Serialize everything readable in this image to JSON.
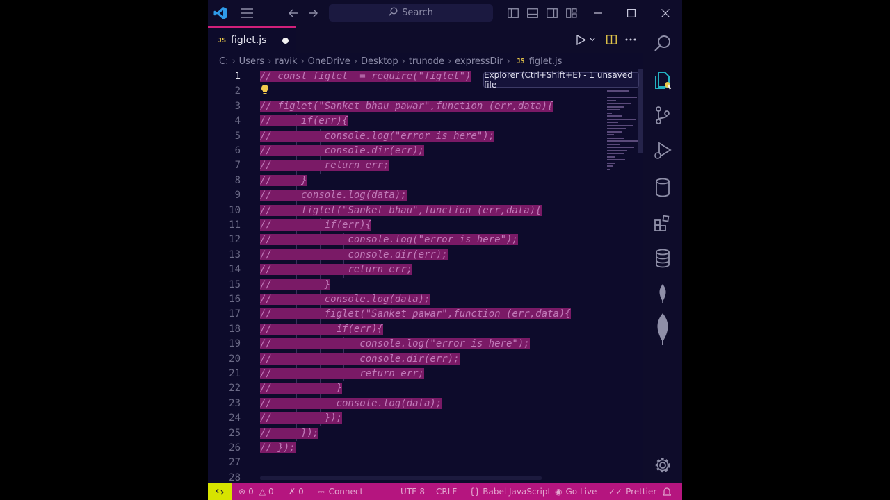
{
  "titlebar": {
    "search_label": "Search"
  },
  "tab": {
    "badge": "JS",
    "filename": "figlet.js"
  },
  "breadcrumb": [
    "C:",
    "Users",
    "ravik",
    "OneDrive",
    "Desktop",
    "trunode",
    "expressDir",
    "figlet.js"
  ],
  "breadcrumb_file_badge": "JS",
  "tooltip": "Explorer (Ctrl+Shift+E) - 1 unsaved file",
  "code_lines": [
    {
      "n": "1",
      "text": "// const figlet  = require(\"figlet\")"
    },
    {
      "n": "2",
      "text": ""
    },
    {
      "n": "3",
      "text": "// figlet(\"Sanket bhau pawar\",function (err,data){"
    },
    {
      "n": "4",
      "text": "//     if(err){"
    },
    {
      "n": "5",
      "text": "//         console.log(\"error is here\");"
    },
    {
      "n": "6",
      "text": "//         console.dir(err);"
    },
    {
      "n": "7",
      "text": "//         return err;"
    },
    {
      "n": "8",
      "text": "//     }"
    },
    {
      "n": "9",
      "text": "//     console.log(data);"
    },
    {
      "n": "10",
      "text": "//     figlet(\"Sanket bhau\",function (err,data){"
    },
    {
      "n": "11",
      "text": "//         if(err){"
    },
    {
      "n": "12",
      "text": "//             console.log(\"error is here\");"
    },
    {
      "n": "13",
      "text": "//             console.dir(err);"
    },
    {
      "n": "14",
      "text": "//             return err;"
    },
    {
      "n": "15",
      "text": "//         }"
    },
    {
      "n": "16",
      "text": "//         console.log(data);"
    },
    {
      "n": "17",
      "text": "//         figlet(\"Sanket pawar\",function (err,data){"
    },
    {
      "n": "18",
      "text": "//           if(err){"
    },
    {
      "n": "19",
      "text": "//               console.log(\"error is here\");"
    },
    {
      "n": "20",
      "text": "//               console.dir(err);"
    },
    {
      "n": "21",
      "text": "//               return err;"
    },
    {
      "n": "22",
      "text": "//           }"
    },
    {
      "n": "23",
      "text": "//           console.log(data);"
    },
    {
      "n": "24",
      "text": "//         });"
    },
    {
      "n": "25",
      "text": "//     });"
    },
    {
      "n": "26",
      "text": "// });"
    },
    {
      "n": "27",
      "text": ""
    },
    {
      "n": "28",
      "text": ""
    }
  ],
  "status": {
    "errors": "0",
    "warnings": "0",
    "ports": "0",
    "connect": "Connect",
    "encoding": "UTF-8",
    "eol": "CRLF",
    "language": "Babel JavaScript",
    "golive": "Go Live",
    "prettier": "Prettier"
  },
  "colors": {
    "selection": "#7a1a66",
    "status_bar": "#b5157f",
    "remote_button": "#d7e300",
    "tab_accent": "#d1207a",
    "editor_bg": "#0d0b2b",
    "explorer_icon": "#23b2c2"
  },
  "icons": [
    "vscode-logo-icon",
    "menu-icon",
    "back-arrow-icon",
    "forward-arrow-icon",
    "search-icon",
    "toggle-sidebar-icon",
    "toggle-panel-icon",
    "toggle-secondary-sidebar-icon",
    "customize-layout-icon",
    "minimize-icon",
    "maximize-icon",
    "close-icon",
    "run-icon",
    "split-editor-icon",
    "more-actions-icon",
    "explorer-icon",
    "source-control-icon",
    "run-debug-icon",
    "database-icon",
    "extensions-icon",
    "sql-database-icon",
    "mongodb-leaf-icon",
    "settings-gear-icon",
    "remote-icon",
    "error-icon",
    "warning-icon",
    "ports-icon",
    "connect-plug-icon",
    "golive-icon",
    "prettier-check-icon",
    "notifications-bell-icon"
  ]
}
